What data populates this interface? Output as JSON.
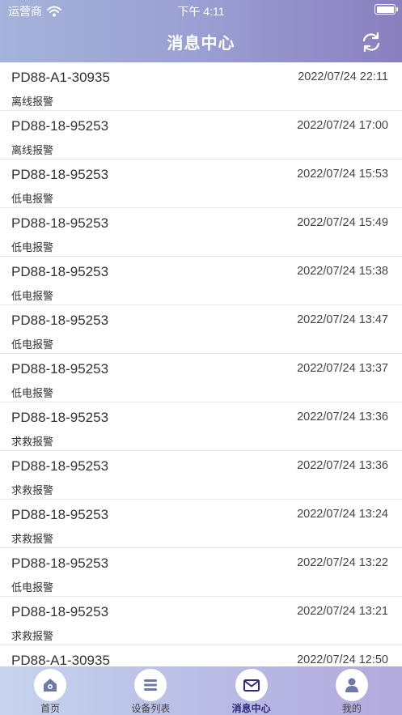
{
  "status": {
    "carrier": "运营商",
    "time": "下午 4:11"
  },
  "header": {
    "title": "消息中心"
  },
  "messages": [
    {
      "device": "PD88-A1-30935",
      "time": "2022/07/24 22:11",
      "type": "离线报警"
    },
    {
      "device": "PD88-18-95253",
      "time": "2022/07/24 17:00",
      "type": "离线报警"
    },
    {
      "device": "PD88-18-95253",
      "time": "2022/07/24 15:53",
      "type": "低电报警"
    },
    {
      "device": "PD88-18-95253",
      "time": "2022/07/24 15:49",
      "type": "低电报警"
    },
    {
      "device": "PD88-18-95253",
      "time": "2022/07/24 15:38",
      "type": "低电报警"
    },
    {
      "device": "PD88-18-95253",
      "time": "2022/07/24 13:47",
      "type": "低电报警"
    },
    {
      "device": "PD88-18-95253",
      "time": "2022/07/24 13:37",
      "type": "低电报警"
    },
    {
      "device": "PD88-18-95253",
      "time": "2022/07/24 13:36",
      "type": "求救报警"
    },
    {
      "device": "PD88-18-95253",
      "time": "2022/07/24 13:36",
      "type": "求救报警"
    },
    {
      "device": "PD88-18-95253",
      "time": "2022/07/24 13:24",
      "type": "求救报警"
    },
    {
      "device": "PD88-18-95253",
      "time": "2022/07/24 13:22",
      "type": "低电报警"
    },
    {
      "device": "PD88-18-95253",
      "time": "2022/07/24 13:21",
      "type": "求救报警"
    },
    {
      "device": "PD88-A1-30935",
      "time": "2022/07/24 12:50",
      "type": ""
    }
  ],
  "tabs": [
    {
      "label": "首页",
      "icon": "home-icon"
    },
    {
      "label": "设备列表",
      "icon": "list-icon"
    },
    {
      "label": "消息中心",
      "icon": "mail-icon",
      "active": true
    },
    {
      "label": "我的",
      "icon": "user-icon"
    }
  ],
  "colors": {
    "header_start": "#a4b3da",
    "header_end": "#8a7fbf",
    "active_tab": "#2d2a7a"
  }
}
